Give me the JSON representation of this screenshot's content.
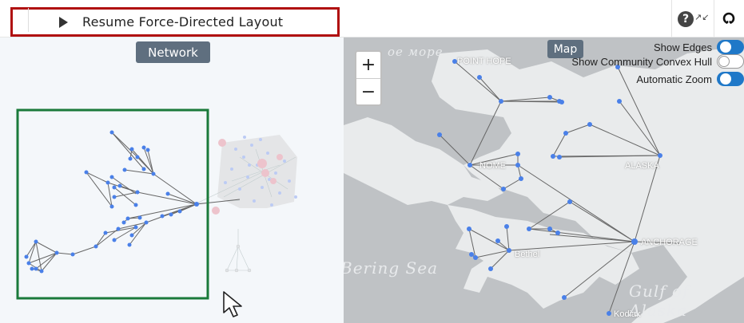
{
  "toolbar": {
    "resume_label": "Resume Force-Directed Layout",
    "help_icon": "help-circle-icon",
    "collapse_icon": "collapse-arrows-icon",
    "github_icon": "github-icon"
  },
  "network": {
    "badge": "Network"
  },
  "map": {
    "badge": "Map",
    "zoom_in": "+",
    "zoom_out": "−",
    "options": [
      {
        "label": "Show Edges",
        "on": true
      },
      {
        "label": "Show Community Convex Hull",
        "on": false
      },
      {
        "label": "Automatic Zoom",
        "on": true
      }
    ],
    "places": [
      "POINT HOPE",
      "NOME",
      "ALASKA",
      "ANCHORAGE",
      "Bethel",
      "Kodiak"
    ],
    "seas": [
      "Bering Sea",
      "Gulf of Alaska",
      "ое море"
    ]
  },
  "colors": {
    "node": "#4a80e8",
    "edge": "#666666",
    "highlight_box": "#1a7a3a",
    "button_border": "#b01010",
    "toggle_on": "#1f78c8",
    "badge_bg": "#5f6f7f"
  }
}
